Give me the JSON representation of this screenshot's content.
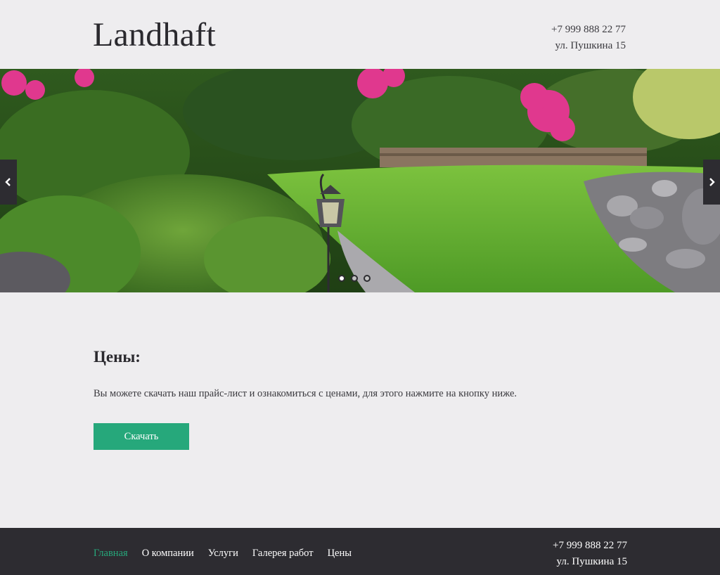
{
  "header": {
    "logo": "Landhaft",
    "phone": "+7 999 888 22 77",
    "address": "ул. Пушкина 15"
  },
  "slider": {
    "image_icon": "garden-photo",
    "prev_icon": "chevron-left-icon",
    "next_icon": "chevron-right-icon",
    "slide_count": 3,
    "active_slide": 1,
    "colors": {
      "lawn": "#5fae2f",
      "shrub": "#3f7a24",
      "flowers": "#e0388e",
      "stone": "#9a9a9e"
    }
  },
  "content": {
    "title": "Цены:",
    "text": "Вы можете скачать наш прайс-лист и ознакомиться с ценами, для этого нажмите на кнопку ниже.",
    "button_label": "Скачать"
  },
  "footer": {
    "nav": [
      "Главная",
      "О компании",
      "Услуги",
      "Галерея работ",
      "Цены"
    ],
    "active_nav": "Главная",
    "phone": "+7 999 888 22 77",
    "address": "ул. Пушкина 15"
  },
  "colors": {
    "accent": "#26a87b",
    "background": "#eeedef",
    "footer_bg": "#2d2c31"
  }
}
